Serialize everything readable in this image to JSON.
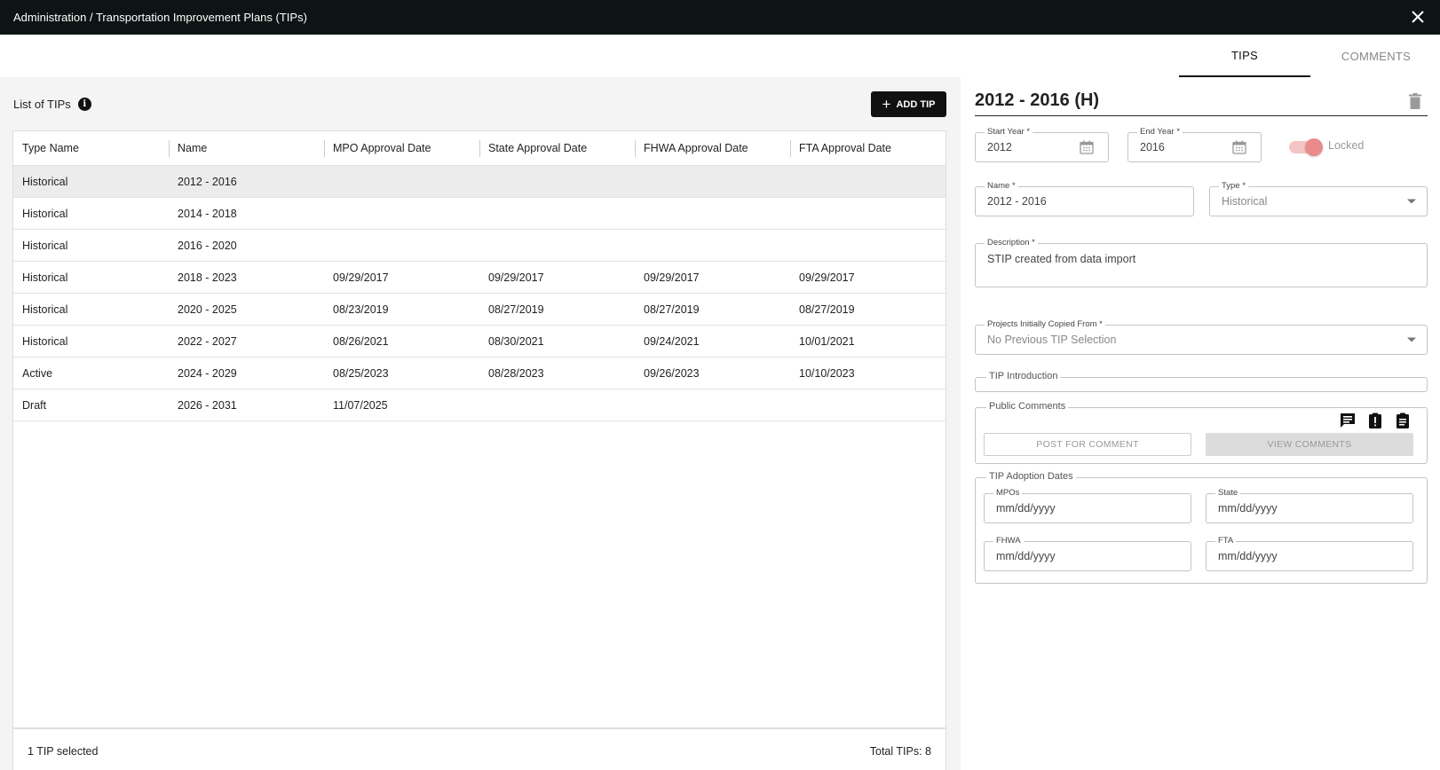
{
  "window": {
    "title": "Administration / Transportation Improvement Plans (TIPs)"
  },
  "tabs": [
    {
      "label": "TIPS",
      "active": true
    },
    {
      "label": "COMMENTS",
      "active": false
    }
  ],
  "list": {
    "title": "List of TIPs",
    "add_button_label": "ADD TIP",
    "columns": [
      "Type Name",
      "Name",
      "MPO Approval Date",
      "State Approval Date",
      "FHWA Approval Date",
      "FTA Approval Date"
    ],
    "rows": [
      [
        "Historical",
        "2012 - 2016",
        "",
        "",
        "",
        ""
      ],
      [
        "Historical",
        "2014 - 2018",
        "",
        "",
        "",
        ""
      ],
      [
        "Historical",
        "2016 - 2020",
        "",
        "",
        "",
        ""
      ],
      [
        "Historical",
        "2018 - 2023",
        "09/29/2017",
        "09/29/2017",
        "09/29/2017",
        "09/29/2017"
      ],
      [
        "Historical",
        "2020 - 2025",
        "08/23/2019",
        "08/27/2019",
        "08/27/2019",
        "08/27/2019"
      ],
      [
        "Historical",
        "2022 - 2027",
        "08/26/2021",
        "08/30/2021",
        "09/24/2021",
        "10/01/2021"
      ],
      [
        "Active",
        "2024 - 2029",
        "08/25/2023",
        "08/28/2023",
        "09/26/2023",
        "10/10/2023"
      ],
      [
        "Draft",
        "2026 - 2031",
        "11/07/2025",
        "",
        "",
        ""
      ]
    ],
    "selected_row_index": 0,
    "footer_selected": "1 TIP selected",
    "footer_total": "Total TIPs: 8"
  },
  "detail": {
    "title": "2012 - 2016 (H)",
    "start_year": {
      "label": "Start Year *",
      "value": "2012"
    },
    "end_year": {
      "label": "End Year *",
      "value": "2016"
    },
    "locked": {
      "label": "Locked",
      "on": true
    },
    "name": {
      "label": "Name *",
      "value": "2012 - 2016"
    },
    "type": {
      "label": "Type *",
      "value": "Historical"
    },
    "description": {
      "label": "Description *",
      "value": "STIP created from data import"
    },
    "copied_from": {
      "label": "Projects Initially Copied From *",
      "value": "No Previous TIP Selection"
    },
    "tip_introduction": {
      "label": "TIP Introduction"
    },
    "public_comments": {
      "label": "Public Comments",
      "post_button": "POST FOR COMMENT",
      "view_button": "VIEW COMMENTS"
    },
    "adoption_dates": {
      "label": "TIP Adoption Dates",
      "mpos": {
        "label": "MPOs",
        "placeholder": "mm/dd/yyyy"
      },
      "state": {
        "label": "State",
        "placeholder": "mm/dd/yyyy"
      },
      "fhwa": {
        "label": "FHWA",
        "placeholder": "mm/dd/yyyy"
      },
      "fta": {
        "label": "FTA",
        "placeholder": "mm/dd/yyyy"
      }
    }
  },
  "colors": {
    "titlebar_bg": "#0d1414",
    "selected_row_bg": "#ececec",
    "toggle_knob": "#e98b8b",
    "toggle_track": "#f3c4c4"
  }
}
